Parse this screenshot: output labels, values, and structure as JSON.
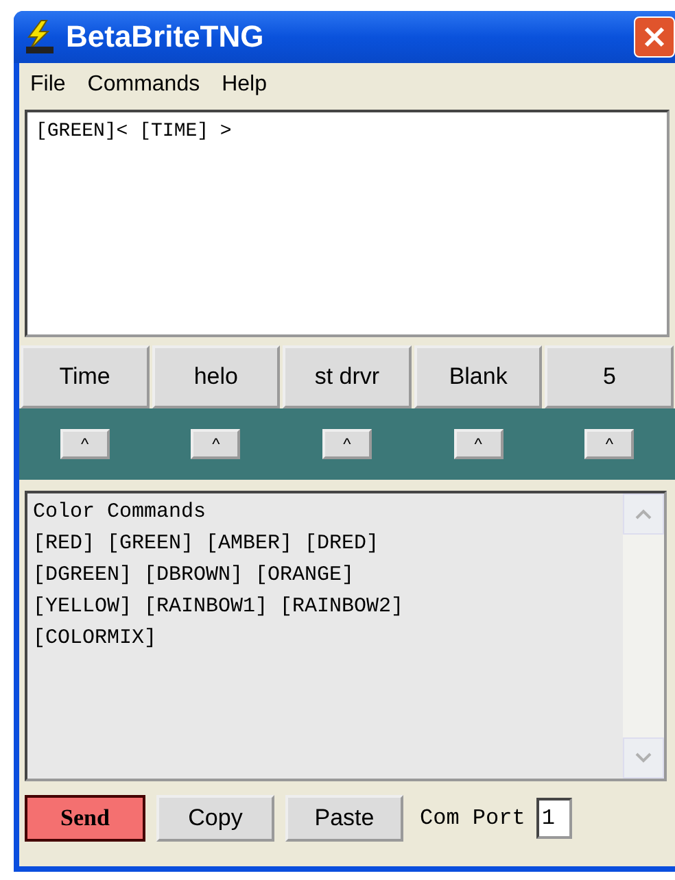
{
  "window": {
    "title": "BetaBriteTNG"
  },
  "menu": [
    "File",
    "Commands",
    "Help"
  ],
  "editor": {
    "value": "[GREEN]< [TIME] >"
  },
  "macro_buttons": [
    {
      "label": "Time",
      "arrow": "^"
    },
    {
      "label": "helo",
      "arrow": "^"
    },
    {
      "label": "st drvr",
      "arrow": "^"
    },
    {
      "label": "Blank",
      "arrow": "^"
    },
    {
      "label": "5",
      "arrow": "^"
    }
  ],
  "help_text": {
    "lines": [
      "Color Commands",
      "[RED] [GREEN] [AMBER] [DRED]",
      "[DGREEN] [DBROWN] [ORANGE]",
      "[YELLOW] [RAINBOW1] [RAINBOW2]",
      "[COLORMIX]"
    ]
  },
  "bottom_bar": {
    "buttons": [
      {
        "label": "Send",
        "kind": "primary"
      },
      {
        "label": "Copy",
        "kind": "normal"
      },
      {
        "label": "Paste",
        "kind": "normal"
      }
    ],
    "com_port_label": "Com Port",
    "com_port_value": "1"
  }
}
